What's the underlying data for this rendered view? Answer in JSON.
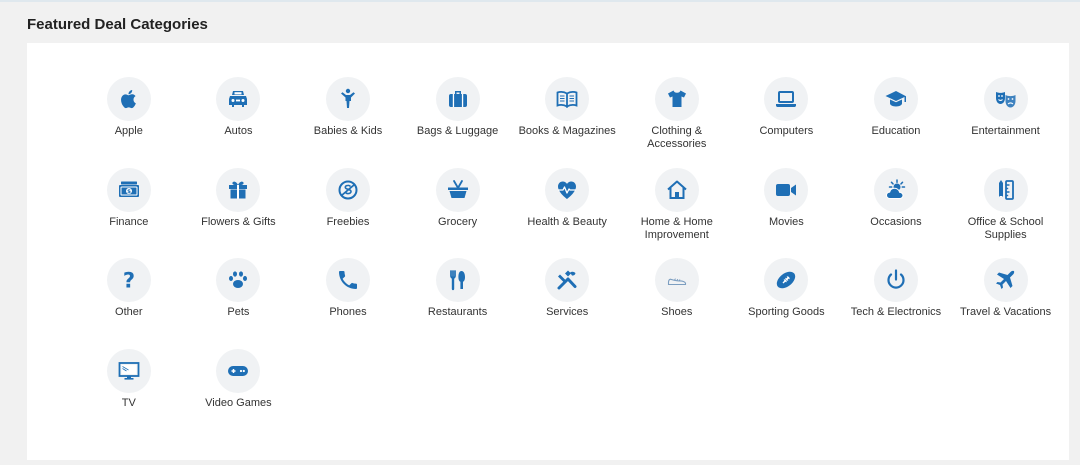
{
  "heading": "Featured Deal Categories",
  "accent_color": "#1f6fb5",
  "categories": [
    {
      "label": "Apple",
      "icon": "apple-icon"
    },
    {
      "label": "Autos",
      "icon": "car-icon"
    },
    {
      "label": "Babies & Kids",
      "icon": "child-icon"
    },
    {
      "label": "Bags & Luggage",
      "icon": "suitcase-icon"
    },
    {
      "label": "Books & Magazines",
      "icon": "book-icon"
    },
    {
      "label": "Clothing & Accessories",
      "icon": "tshirt-icon"
    },
    {
      "label": "Computers",
      "icon": "laptop-icon"
    },
    {
      "label": "Education",
      "icon": "graduation-cap-icon"
    },
    {
      "label": "Entertainment",
      "icon": "theater-masks-icon"
    },
    {
      "label": "Finance",
      "icon": "money-icon"
    },
    {
      "label": "Flowers & Gifts",
      "icon": "gift-icon"
    },
    {
      "label": "Freebies",
      "icon": "free-icon"
    },
    {
      "label": "Grocery",
      "icon": "basket-icon"
    },
    {
      "label": "Health & Beauty",
      "icon": "heartbeat-icon"
    },
    {
      "label": "Home & Home Improvement",
      "icon": "house-icon"
    },
    {
      "label": "Movies",
      "icon": "video-camera-icon"
    },
    {
      "label": "Occasions",
      "icon": "sun-cloud-icon"
    },
    {
      "label": "Office & School Supplies",
      "icon": "pencil-ruler-icon"
    },
    {
      "label": "Other",
      "icon": "question-icon"
    },
    {
      "label": "Pets",
      "icon": "paw-icon"
    },
    {
      "label": "Phones",
      "icon": "phone-icon"
    },
    {
      "label": "Restaurants",
      "icon": "utensils-icon"
    },
    {
      "label": "Services",
      "icon": "tools-icon"
    },
    {
      "label": "Shoes",
      "icon": "shoe-icon"
    },
    {
      "label": "Sporting Goods",
      "icon": "football-icon"
    },
    {
      "label": "Tech & Electronics",
      "icon": "power-icon"
    },
    {
      "label": "Travel & Vacations",
      "icon": "plane-icon"
    },
    {
      "label": "TV",
      "icon": "tv-icon"
    },
    {
      "label": "Video Games",
      "icon": "gamepad-icon"
    }
  ]
}
